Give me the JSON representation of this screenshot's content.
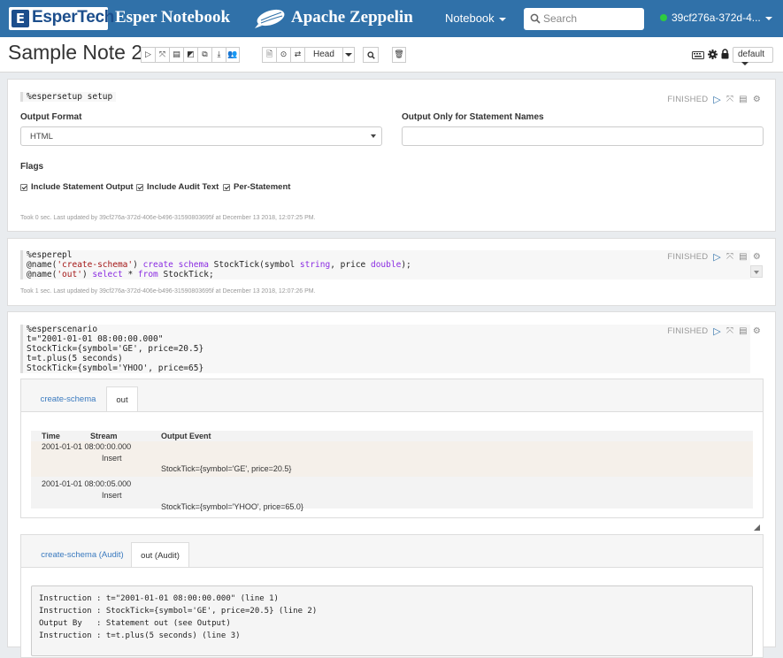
{
  "navbar": {
    "logo_mark": "E",
    "logo_text": "EsperTech",
    "product": "Esper Notebook",
    "zeppelin": "Apache Zeppelin",
    "menu_notebook": "Notebook",
    "search_placeholder": "Search",
    "user": "39cf276a-372d-4...",
    "colors": {
      "bar": "#3071a9",
      "status_dot": "#2ecc40"
    }
  },
  "note": {
    "title": "Sample Note 2",
    "head_label": "Head",
    "default_label": "default"
  },
  "paragraphs": [
    {
      "code": [
        "%espersetup setup"
      ],
      "status": "FINISHED",
      "form": {
        "output_format_label": "Output Format",
        "output_format_value": "HTML",
        "statement_names_label": "Output Only for Statement Names",
        "statement_names_value": "",
        "flags_label": "Flags",
        "flags": [
          "Include Statement Output",
          "Include Audit Text",
          "Per-Statement"
        ]
      },
      "meta": "Took 0 sec. Last updated by 39cf276a-372d-406e-b496-31590803695f at December 13 2018, 12:07:25 PM."
    },
    {
      "code_lines": [
        [
          {
            "t": "%esperepl"
          }
        ],
        [
          {
            "t": "@name("
          },
          {
            "t": "'create-schema'",
            "c": "s"
          },
          {
            "t": ") "
          },
          {
            "t": "create schema",
            "c": "k"
          },
          {
            "t": " StockTick(symbol "
          },
          {
            "t": "string",
            "c": "k"
          },
          {
            "t": ", price "
          },
          {
            "t": "double",
            "c": "k"
          },
          {
            "t": ");"
          }
        ],
        [
          {
            "t": "@name("
          },
          {
            "t": "'out'",
            "c": "s"
          },
          {
            "t": ") "
          },
          {
            "t": "select",
            "c": "k"
          },
          {
            "t": " * "
          },
          {
            "t": "from",
            "c": "k"
          },
          {
            "t": " StockTick;"
          }
        ]
      ],
      "status": "FINISHED",
      "meta": "Took 1 sec. Last updated by 39cf276a-372d-406e-b496-31590803695f at December 13 2018, 12:07:26 PM."
    },
    {
      "code": [
        "%esperscenario",
        "t=\"2001-01-01 08:00:00.000\"",
        "StockTick={symbol='GE', price=20.5}",
        "t=t.plus(5 seconds)",
        "StockTick={symbol='YHOO', price=65}"
      ],
      "status": "FINISHED",
      "result_tabs": [
        "create-schema",
        "out"
      ],
      "result_table": {
        "headers": [
          "Time",
          "Stream",
          "Output Event"
        ],
        "rows": [
          {
            "time": "2001-01-01 08:00:00.000",
            "stream": "Insert",
            "event": "StockTick={symbol='GE', price=20.5}"
          },
          {
            "time": "2001-01-01 08:00:05.000",
            "stream": "Insert",
            "event": "StockTick={symbol='YHOO', price=65.0}"
          }
        ]
      },
      "audit_tabs": [
        "create-schema (Audit)",
        "out (Audit)"
      ],
      "audit_lines": [
        "Instruction : t=\"2001-01-01 08:00:00.000\" (line 1)",
        "Instruction : StockTick={symbol='GE', price=20.5} (line 2)",
        "Output By   : Statement out (see Output)",
        "Instruction : t=t.plus(5 seconds) (line 3)"
      ]
    }
  ]
}
